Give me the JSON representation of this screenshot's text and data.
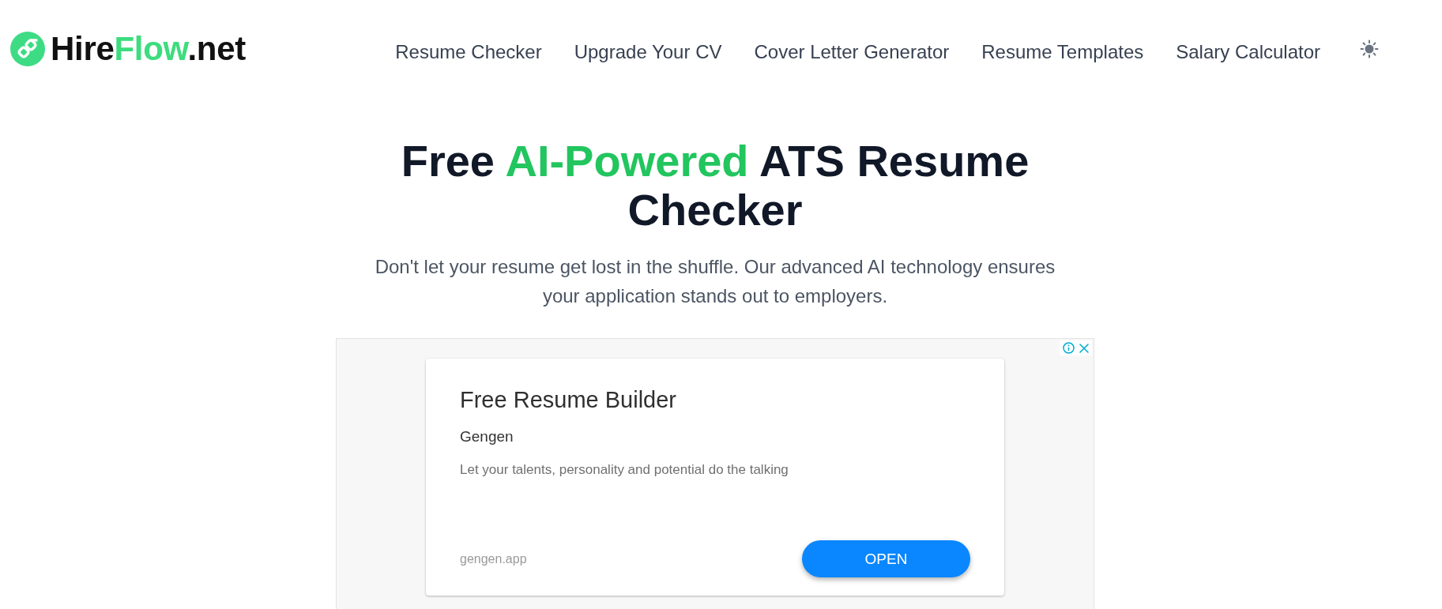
{
  "header": {
    "logo": [
      {
        "text": "Hire",
        "highlight": false
      },
      {
        "text": "Flow",
        "highlight": true
      },
      {
        "text": ".net",
        "highlight": false
      }
    ],
    "nav": [
      "Resume Checker",
      "Upgrade Your CV",
      "Cover Letter Generator",
      "Resume Templates",
      "Salary Calculator"
    ]
  },
  "hero": {
    "title": [
      {
        "text": "Free ",
        "highlight": false
      },
      {
        "text": "AI-Powered",
        "highlight": true
      },
      {
        "text": " ATS Resume Checker",
        "highlight": false
      }
    ],
    "subtitle": "Don't let your resume get lost in the shuffle. Our advanced AI technology ensures your application stands out to employers."
  },
  "ad": {
    "title": "Free Resume Builder",
    "advertiser": "Gengen",
    "description": "Let your talents, personality and potential do the talking",
    "url": "gengen.app",
    "button": "OPEN"
  }
}
